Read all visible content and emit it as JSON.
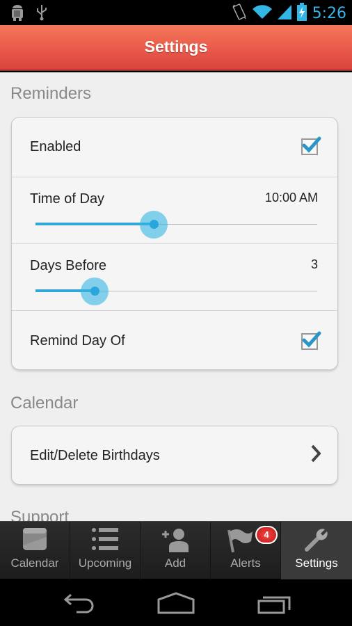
{
  "status_bar": {
    "time": "5:26",
    "left_icons": [
      "android-debug-icon",
      "usb-icon"
    ],
    "right_icons": [
      "vibrate-icon",
      "wifi-icon",
      "signal-icon",
      "battery-charging-icon"
    ]
  },
  "action_bar": {
    "title": "Settings"
  },
  "sections": {
    "reminders": {
      "title": "Reminders",
      "enabled": {
        "label": "Enabled",
        "checked": true
      },
      "time_of_day": {
        "label": "Time of Day",
        "value": "10:00 AM",
        "slider_fraction": 0.42
      },
      "days_before": {
        "label": "Days Before",
        "value": "3",
        "slider_fraction": 0.21
      },
      "remind_day_of": {
        "label": "Remind Day Of",
        "checked": true
      }
    },
    "calendar": {
      "title": "Calendar",
      "edit_birthdays": {
        "label": "Edit/Delete Birthdays"
      }
    },
    "support": {
      "title": "Support"
    }
  },
  "tab_bar": {
    "tabs": [
      {
        "label": "Calendar",
        "icon": "calendar-icon",
        "active": false
      },
      {
        "label": "Upcoming",
        "icon": "list-icon",
        "active": false
      },
      {
        "label": "Add",
        "icon": "add-person-icon",
        "active": false
      },
      {
        "label": "Alerts",
        "icon": "flag-icon",
        "active": false,
        "badge": "4"
      },
      {
        "label": "Settings",
        "icon": "wrench-icon",
        "active": true
      }
    ]
  },
  "nav_bar": {
    "buttons": [
      "back",
      "home",
      "recents"
    ]
  },
  "colors": {
    "accent": "#33b5e5",
    "action_bar": "#e9594a",
    "badge": "#d42020"
  }
}
